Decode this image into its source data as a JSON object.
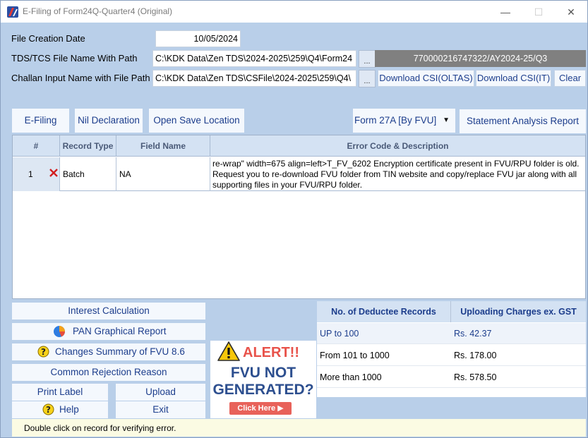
{
  "window": {
    "title": "E-Filing of Form24Q-Quarter4 (Original)",
    "minimize": "—",
    "maximize": "☐",
    "close": "✕"
  },
  "form": {
    "creation_date_label": "File Creation Date",
    "creation_date_value": "10/05/2024",
    "file_name_label": "TDS/TCS File Name With Path",
    "file_name_value": "C:\\KDK Data\\Zen TDS\\2024-2025\\259\\Q4\\Form24",
    "challan_label": "Challan Input Name with File Path",
    "challan_value": "C:\\KDK Data\\Zen TDS\\CSFile\\2024-2025\\259\\Q4\\",
    "browse_label": "...",
    "pan_info": "770000216747322/AY2024-25/Q3",
    "download_oltas": "Download CSI(OLTAS)",
    "download_it": "Download CSI(IT)",
    "clear": "Clear"
  },
  "toolbar": {
    "efiling": "E-Filing",
    "nil_declaration": "Nil Declaration",
    "open_save_location": "Open Save Location",
    "form_select": "Form 27A [By FVU]",
    "form_select_arrow": "▼",
    "statement_report": "Statement Analysis Report"
  },
  "grid": {
    "columns": [
      "#",
      "Record Type",
      "Field Name",
      "Error Code & Description"
    ],
    "rows": [
      {
        "num": "1",
        "record_type": "Batch",
        "field_name": "NA",
        "description": "re-wrap\" width=675 align=left>T_FV_6202 Encryption certificate present in FVU/RPU folder is old. Request you to re-download FVU folder from TIN website and copy/replace FVU jar along with all supporting files in your FVU/RPU folder."
      }
    ]
  },
  "side": {
    "interest": "Interest Calculation",
    "pan_report": "PAN Graphical Report",
    "changes_summary": "Changes Summary of FVU 8.6",
    "rejection": "Common Rejection Reason",
    "print_label": "Print Label",
    "upload": "Upload",
    "help": "Help",
    "exit": "Exit"
  },
  "charges": {
    "col1": "No. of Deductee Records",
    "col2": "Uploading Charges ex. GST",
    "rows": [
      {
        "range": "UP to 100",
        "charge": "Rs. 42.37"
      },
      {
        "range": "From 101 to 1000",
        "charge": "Rs. 178.00"
      },
      {
        "range": "More than 1000",
        "charge": "Rs. 578.50"
      }
    ]
  },
  "ad": {
    "alert": "ALERT!!",
    "line1": "FVU NOT",
    "line2": "GENERATED?",
    "cta": "Click Here ▶"
  },
  "status": {
    "text": "Double click on record for verifying error."
  },
  "colors": {
    "background": "#b9cfe9",
    "link_blue": "#1c3d8c",
    "alert_red": "#e8524a",
    "fvu_blue": "#2d4f8f"
  }
}
